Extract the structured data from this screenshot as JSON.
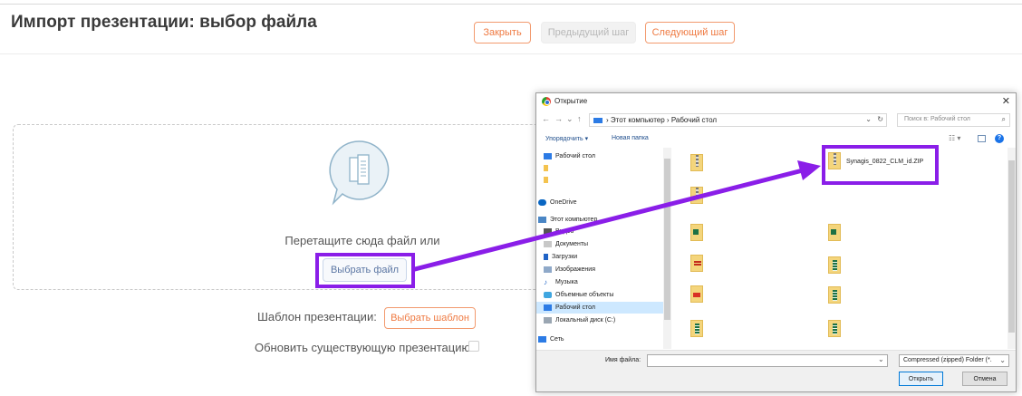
{
  "page": {
    "title": "Импорт презентации: выбор файла",
    "buttons": {
      "close": "Закрыть",
      "prev": "Предыдущий шаг",
      "next": "Следующий шаг"
    }
  },
  "upload": {
    "drop_text": "Перетащите сюда файл или",
    "choose_label": "Выбрать файл"
  },
  "template": {
    "label": "Шаблон презентации:",
    "choose_label": "Выбрать шаблон"
  },
  "update": {
    "label": "Обновить существующую презентацию",
    "checked": false
  },
  "dialog": {
    "title": "Открытие",
    "breadcrumb": "› Этот компьютер › Рабочий стол",
    "search_placeholder": "Поиск в: Рабочий стол",
    "organize": "Упорядочить ▾",
    "new_folder": "Новая папка",
    "nav_items": [
      {
        "label": "Рабочий стол",
        "icon": "desktop-folder-icon"
      },
      {
        "label": "",
        "icon": "folder-icon"
      },
      {
        "label": "",
        "icon": "folder-icon"
      },
      {
        "label": "OneDrive",
        "icon": "cloud-icon"
      },
      {
        "label": "Этот компьютер",
        "icon": "computer-icon"
      },
      {
        "label": "Видео",
        "icon": "video-icon"
      },
      {
        "label": "Документы",
        "icon": "documents-icon"
      },
      {
        "label": "Загрузки",
        "icon": "downloads-icon"
      },
      {
        "label": "Изображения",
        "icon": "pictures-icon"
      },
      {
        "label": "Музыка",
        "icon": "music-icon"
      },
      {
        "label": "Объемные объекты",
        "icon": "3d-objects-icon"
      },
      {
        "label": "Рабочий стол",
        "icon": "desktop-folder-icon"
      },
      {
        "label": "Локальный диск (C:)",
        "icon": "drive-icon"
      },
      {
        "label": "Сеть",
        "icon": "network-icon"
      }
    ],
    "selected_file": "Synagis_0822_CLM_id.ZIP",
    "filename_label": "Имя файла:",
    "filename_value": "",
    "filetype": "Compressed (zipped) Folder (*.",
    "open_label": "Открыть",
    "cancel_label": "Отмена"
  },
  "colors": {
    "accent_orange": "#ef7a42",
    "highlight_purple": "#8a1ee8",
    "link_blue": "#5b76a3"
  }
}
